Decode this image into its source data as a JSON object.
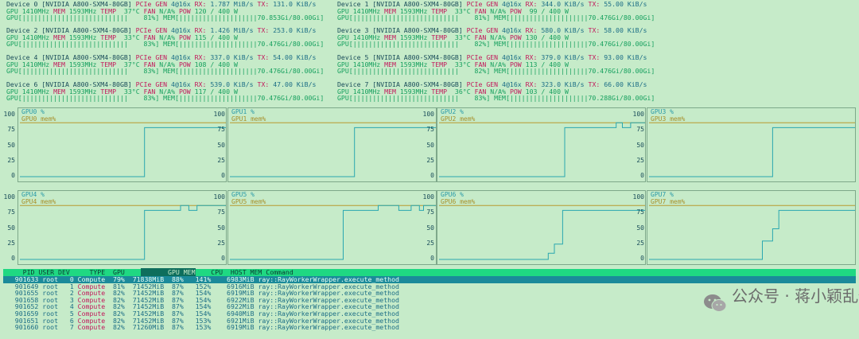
{
  "devices": [
    {
      "line1": [
        "Device 0 [NVIDIA A800-SXM4-80GB] ",
        "PCIe GEN",
        " 4@16x ",
        "RX:",
        " 1.787 MiB/s ",
        "TX:",
        " 131.0 KiB/s"
      ],
      "line2": [
        "GPU 1410MHz ",
        "MEM",
        " 1593MHz ",
        "TEMP",
        "  37°C ",
        "FAN",
        " N/A% ",
        "POW",
        " 120 / 400 W"
      ],
      "line3": "GPU[|||||||||||||||||||||||||||    81%] MEM[||||||||||||||||||||70.853Gi/80.00Gi]"
    },
    {
      "line1": [
        "Device 1 [NVIDIA A800-SXM4-80GB] ",
        "PCIe GEN",
        " 4@16x ",
        "RX:",
        " 344.0 KiB/s ",
        "TX:",
        " 55.00 KiB/s"
      ],
      "line2": [
        "GPU 1410MHz ",
        "MEM",
        " 1593MHz ",
        "TEMP",
        "  33°C ",
        "FAN",
        " N/A% ",
        "POW",
        "  99 / 400 W"
      ],
      "line3": "GPU[|||||||||||||||||||||||||||    81%] MEM[||||||||||||||||||||70.476Gi/80.00Gi]"
    },
    {
      "line1": [
        "Device 2 [NVIDIA A800-SXM4-80GB] ",
        "PCIe GEN",
        " 4@16x ",
        "RX:",
        " 1.426 MiB/s ",
        "TX:",
        " 253.0 KiB/s"
      ],
      "line2": [
        "GPU 1410MHz ",
        "MEM",
        " 1593MHz ",
        "TEMP",
        "  33°C ",
        "FAN",
        " N/A% ",
        "POW",
        " 115 / 400 W"
      ],
      "line3": "GPU[|||||||||||||||||||||||||||    83%] MEM[||||||||||||||||||||70.476Gi/80.00Gi]"
    },
    {
      "line1": [
        "Device 3 [NVIDIA A800-SXM4-80GB] ",
        "PCIe GEN",
        " 4@16x ",
        "RX:",
        " 580.0 KiB/s ",
        "TX:",
        " 58.00 KiB/s"
      ],
      "line2": [
        "GPU 1410MHz ",
        "MEM",
        " 1593MHz ",
        "TEMP",
        "  33°C ",
        "FAN",
        " N/A% ",
        "POW",
        " 130 / 400 W"
      ],
      "line3": "GPU[|||||||||||||||||||||||||||    82%] MEM[||||||||||||||||||||70.476Gi/80.00Gi]"
    },
    {
      "line1": [
        "Device 4 [NVIDIA A800-SXM4-80GB] ",
        "PCIe GEN",
        " 4@16x ",
        "RX:",
        " 337.0 KiB/s ",
        "TX:",
        " 54.00 KiB/s"
      ],
      "line2": [
        "GPU 1410MHz ",
        "MEM",
        " 1593MHz ",
        "TEMP",
        "  37°C ",
        "FAN",
        " N/A% ",
        "POW",
        " 108 / 400 W"
      ],
      "line3": "GPU[|||||||||||||||||||||||||||    83%] MEM[||||||||||||||||||||70.476Gi/80.00Gi]"
    },
    {
      "line1": [
        "Device 5 [NVIDIA A800-SXM4-80GB] ",
        "PCIe GEN",
        " 4@16x ",
        "RX:",
        " 379.0 KiB/s ",
        "TX:",
        " 93.00 KiB/s"
      ],
      "line2": [
        "GPU 1410MHz ",
        "MEM",
        " 1593MHz ",
        "TEMP",
        "  33°C ",
        "FAN",
        " N/A% ",
        "POW",
        " 113 / 400 W"
      ],
      "line3": "GPU[|||||||||||||||||||||||||||    82%] MEM[||||||||||||||||||||70.476Gi/80.00Gi]"
    },
    {
      "line1": [
        "Device 6 [NVIDIA A800-SXM4-80GB] ",
        "PCIe GEN",
        " 4@16x ",
        "RX:",
        " 539.0 KiB/s ",
        "TX:",
        " 47.00 KiB/s"
      ],
      "line2": [
        "GPU 1410MHz ",
        "MEM",
        " 1593MHz ",
        "TEMP",
        "  33°C ",
        "FAN",
        " N/A% ",
        "POW",
        " 117 / 400 W"
      ],
      "line3": "GPU[|||||||||||||||||||||||||||    83%] MEM[||||||||||||||||||||70.476Gi/80.00Gi]"
    },
    {
      "line1": [
        "Device 7 [NVIDIA A800-SXM4-80GB] ",
        "PCIe GEN",
        " 4@16x ",
        "RX:",
        " 323.0 KiB/s ",
        "TX:",
        " 66.00 KiB/s"
      ],
      "line2": [
        "GPU 1410MHz ",
        "MEM",
        " 1593MHz ",
        "TEMP",
        "  36°C ",
        "FAN",
        " N/A% ",
        "POW",
        " 103 / 400 W"
      ],
      "line3": "GPU[|||||||||||||||||||||||||||    83%] MEM[||||||||||||||||||||70.288Gi/80.00Gi]"
    }
  ],
  "yticks": [
    "100",
    "75",
    "50",
    "25",
    "0"
  ],
  "colors": {
    "util": "#2aa7b0",
    "mem": "#b89a2f",
    "border": "#7ea88a"
  },
  "chart_data": [
    {
      "type": "line",
      "series": [
        {
          "name": "GPU0 %",
          "values": [
            0,
            0,
            0,
            0,
            0,
            0,
            0,
            0,
            0,
            0,
            0,
            0,
            0,
            0,
            0,
            0,
            0,
            0,
            0,
            0,
            0,
            0,
            0,
            0,
            0,
            0,
            0,
            0,
            0,
            0,
            0,
            0,
            0,
            0,
            0,
            0,
            0,
            0,
            0,
            0,
            0,
            0,
            0,
            0,
            0,
            0,
            0,
            0,
            0,
            0,
            0,
            0,
            0,
            0,
            0,
            0,
            0,
            0,
            0,
            0,
            0,
            0,
            0,
            0,
            0,
            0,
            0,
            0,
            0,
            0,
            0,
            0,
            0,
            0,
            0,
            0,
            0,
            0,
            0,
            0,
            0,
            0,
            0,
            0,
            0,
            0,
            0,
            0,
            0,
            0,
            0,
            0,
            0,
            0,
            0,
            0,
            0,
            0,
            0,
            0,
            0,
            0,
            0,
            0,
            0,
            0,
            0,
            0,
            0,
            0,
            0,
            0,
            0,
            0,
            0,
            0,
            0,
            0,
            0,
            0,
            0,
            0,
            0,
            0,
            0,
            0,
            0,
            0,
            0,
            0,
            0,
            0,
            0,
            0,
            0,
            0,
            0,
            0,
            0,
            0,
            0,
            0,
            0,
            0,
            0,
            0,
            0,
            0,
            80,
            80,
            80,
            80,
            80,
            80,
            80,
            80,
            80,
            80,
            80,
            80,
            80,
            80,
            80,
            80,
            80,
            80,
            80,
            80,
            80,
            80,
            80,
            80,
            80,
            80,
            80,
            80,
            80,
            80,
            80,
            80,
            80,
            80,
            80,
            80,
            80,
            80,
            80,
            80,
            80,
            80,
            80,
            80,
            80,
            80,
            80,
            80,
            80,
            80,
            80,
            80,
            80,
            80,
            80,
            80,
            80,
            80,
            80,
            80,
            80,
            80,
            80,
            80,
            80,
            80,
            80,
            80,
            80,
            80,
            80,
            80,
            80,
            80,
            80,
            80,
            80,
            80,
            80,
            80,
            80,
            80,
            80,
            80,
            80,
            80,
            80,
            80
          ]
        },
        {
          "name": "GPU0 mem%",
          "values": [
            88
          ]
        }
      ],
      "ylim": [
        0,
        100
      ]
    },
    {
      "type": "line",
      "series": [
        {
          "name": "GPU1 %",
          "values": [
            0,
            80
          ]
        },
        {
          "name": "GPU1 mem%",
          "values": [
            88
          ]
        }
      ],
      "ylim": [
        0,
        100
      ]
    },
    {
      "type": "line",
      "series": [
        {
          "name": "GPU2 %",
          "values": [
            0,
            80,
            88,
            80
          ]
        },
        {
          "name": "GPU2 mem%",
          "values": [
            88
          ]
        }
      ],
      "ylim": [
        0,
        100
      ]
    },
    {
      "type": "line",
      "series": [
        {
          "name": "GPU3 %",
          "values": [
            0,
            80
          ]
        },
        {
          "name": "GPU3 mem%",
          "values": [
            88
          ]
        }
      ],
      "ylim": [
        0,
        100
      ]
    },
    {
      "type": "line",
      "series": [
        {
          "name": "GPU4 %",
          "values": [
            0,
            80,
            88,
            80
          ]
        },
        {
          "name": "GPU4 mem%",
          "values": [
            88
          ]
        }
      ],
      "ylim": [
        0,
        100
      ]
    },
    {
      "type": "line",
      "series": [
        {
          "name": "GPU5 %",
          "values": [
            0,
            80,
            88,
            80
          ]
        },
        {
          "name": "GPU5 mem%",
          "values": [
            88
          ]
        }
      ],
      "ylim": [
        0,
        100
      ]
    },
    {
      "type": "line",
      "series": [
        {
          "name": "GPU6 %",
          "values": [
            0,
            10,
            25,
            80
          ]
        },
        {
          "name": "GPU6 mem%",
          "values": [
            88
          ]
        }
      ],
      "ylim": [
        0,
        100
      ]
    },
    {
      "type": "line",
      "series": [
        {
          "name": "GPU7 %",
          "values": [
            0,
            50,
            80
          ]
        },
        {
          "name": "GPU7 mem%",
          "values": [
            88
          ]
        }
      ],
      "ylim": [
        0,
        100
      ]
    }
  ],
  "process_header": {
    "pre": "     PID USER DEV     TYPE  GPU    ",
    "hl": "       GPU MEM",
    "post": "    CPU  HOST MEM Command"
  },
  "processes": [
    {
      "pid": "901633",
      "user": "root",
      "dev": "0",
      "type": "Compute",
      "gpu": "79%",
      "gpumem": "71838MiB",
      "memp": "88%",
      "cpu": "141%",
      "host": "6983MiB",
      "cmd": "ray::RayWorkerWrapper.execute_method"
    },
    {
      "pid": "901649",
      "user": "root",
      "dev": "1",
      "type": "Compute",
      "gpu": "81%",
      "gpumem": "71452MiB",
      "memp": "87%",
      "cpu": "152%",
      "host": "6916MiB",
      "cmd": "ray::RayWorkerWrapper.execute_method"
    },
    {
      "pid": "901655",
      "user": "root",
      "dev": "2",
      "type": "Compute",
      "gpu": "82%",
      "gpumem": "71452MiB",
      "memp": "87%",
      "cpu": "154%",
      "host": "6919MiB",
      "cmd": "ray::RayWorkerWrapper.execute_method"
    },
    {
      "pid": "901658",
      "user": "root",
      "dev": "3",
      "type": "Compute",
      "gpu": "82%",
      "gpumem": "71452MiB",
      "memp": "87%",
      "cpu": "154%",
      "host": "6922MiB",
      "cmd": "ray::RayWorkerWrapper.execute_method"
    },
    {
      "pid": "901652",
      "user": "root",
      "dev": "4",
      "type": "Compute",
      "gpu": "82%",
      "gpumem": "71452MiB",
      "memp": "87%",
      "cpu": "154%",
      "host": "6922MiB",
      "cmd": "ray::RayWorkerWrapper.execute_method"
    },
    {
      "pid": "901659",
      "user": "root",
      "dev": "5",
      "type": "Compute",
      "gpu": "82%",
      "gpumem": "71452MiB",
      "memp": "87%",
      "cpu": "154%",
      "host": "6940MiB",
      "cmd": "ray::RayWorkerWrapper.execute_method"
    },
    {
      "pid": "901651",
      "user": "root",
      "dev": "6",
      "type": "Compute",
      "gpu": "82%",
      "gpumem": "71452MiB",
      "memp": "87%",
      "cpu": "153%",
      "host": "6921MiB",
      "cmd": "ray::RayWorkerWrapper.execute_method"
    },
    {
      "pid": "901660",
      "user": "root",
      "dev": "7",
      "type": "Compute",
      "gpu": "82%",
      "gpumem": "71260MiB",
      "memp": "87%",
      "cpu": "153%",
      "host": "6919MiB",
      "cmd": "ray::RayWorkerWrapper.execute_method"
    }
  ],
  "watermark": {
    "text": "公众号 · 蒋小颖乱侃",
    "icon": "wechat-icon"
  }
}
